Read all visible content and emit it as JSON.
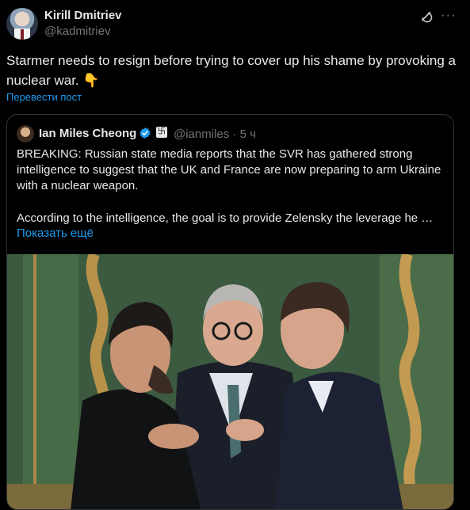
{
  "author": {
    "name": "Kirill Dmitriev",
    "handle": "@kadmitriev"
  },
  "post": {
    "text": "Starmer needs to resign before trying to cover up his shame by provoking a nuclear war. 👇",
    "translate_label": "Перевести пост"
  },
  "icons": [
    "grok-icon",
    "more-options-icon",
    "verified-badge-icon"
  ],
  "quoted": {
    "name": "Ian Miles Cheong",
    "handle": "@ianmiles",
    "separator": "·",
    "time": "5 ч",
    "text": "BREAKING: Russian state media reports that the SVR has gathered strong intelligence to suggest that the UK and France are now preparing to arm Ukraine with a nuclear weapon.",
    "text2": "According to the intelligence, the goal is to provide Zelensky the leverage he …",
    "show_more_label": "Показать ещё"
  },
  "colors": {
    "background": "#000000",
    "text": "#e7e9ea",
    "muted": "#71767b",
    "link": "#1d9bf0",
    "border": "#2f3336",
    "verified": "#1d9bf0"
  }
}
